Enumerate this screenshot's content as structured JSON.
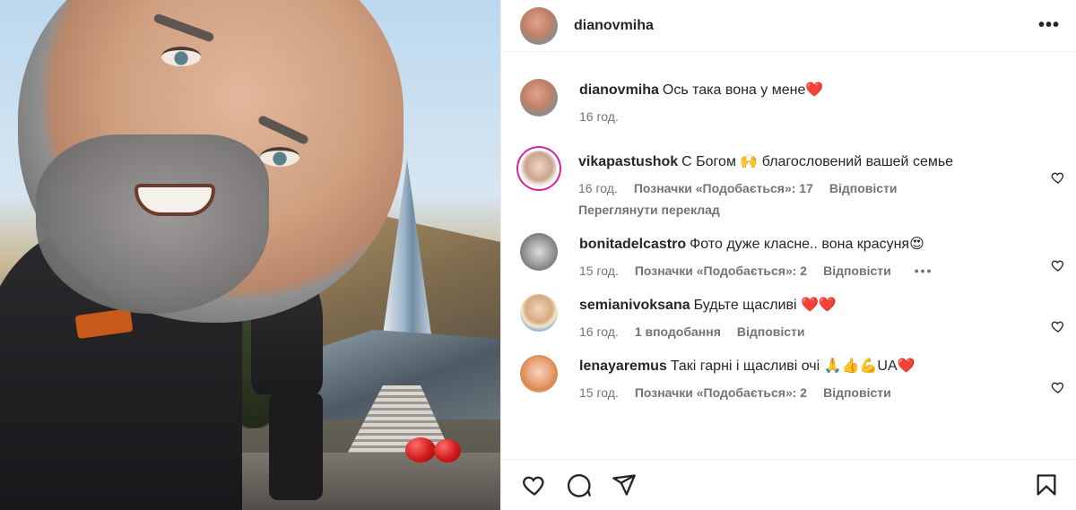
{
  "post": {
    "username": "dianovmiha",
    "more_icon": "more-horizontal-icon"
  },
  "caption": {
    "username": "dianovmiha",
    "text": "Ось така вона у мене",
    "emoji": "❤️",
    "time": "16 год."
  },
  "comments": [
    {
      "username": "vikapastushok",
      "text": "С Богом 🙌 благословений вашей семье",
      "time": "16 год.",
      "likes": "Позначки «Подобається»: 17",
      "reply": "Відповісти",
      "translate": "Переглянути переклад",
      "avatar_color": "#d6249f"
    },
    {
      "username": "bonitadelcastro",
      "text": "Фото дуже класне.. вона красуня😍",
      "time": "15 год.",
      "likes": "Позначки «Подобається»: 2",
      "reply": "Відповісти",
      "more": "•••"
    },
    {
      "username": "semianivoksana",
      "text": "Будьте щасливі ❤️❤️",
      "time": "16 год.",
      "likes": "1 вподобання",
      "reply": "Відповісти"
    },
    {
      "username": "lenayaremus",
      "text": "Такі гарні і щасливі очі 🙏👍💪UA❤️",
      "time": "15 год.",
      "likes": "Позначки «Подобається»: 2",
      "reply": "Відповісти"
    }
  ],
  "actions": {
    "like_icon": "heart-icon",
    "comment_icon": "comment-icon",
    "share_icon": "send-icon",
    "save_icon": "bookmark-icon"
  }
}
